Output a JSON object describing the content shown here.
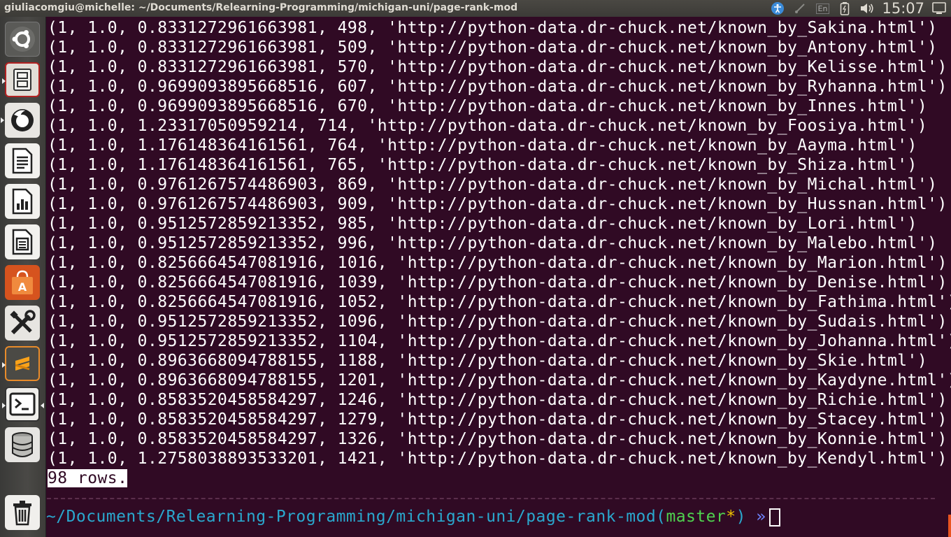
{
  "window": {
    "title": "giuliacomgiu@michelle: ~/Documents/Relearning-Programming/michigan-uni/page-rank-mod"
  },
  "tray": {
    "keyboard": "En",
    "clock": "15:07"
  },
  "launcher": {
    "items": [
      "ubuntu-dash",
      "files",
      "firefox",
      "libreoffice-writer",
      "libreoffice-calc",
      "libreoffice-impress",
      "software-center",
      "system-settings",
      "sublime-text",
      "terminal",
      "database",
      "trash"
    ]
  },
  "terminal": {
    "lines": [
      "(1, 1.0, 0.8331272961663981, 498, 'http://python-data.dr-chuck.net/known_by_Sakina.html')",
      "(1, 1.0, 0.8331272961663981, 509, 'http://python-data.dr-chuck.net/known_by_Antony.html')",
      "(1, 1.0, 0.8331272961663981, 570, 'http://python-data.dr-chuck.net/known_by_Kelisse.html')",
      "(1, 1.0, 0.9699093895668516, 607, 'http://python-data.dr-chuck.net/known_by_Ryhanna.html')",
      "(1, 1.0, 0.9699093895668516, 670, 'http://python-data.dr-chuck.net/known_by_Innes.html')",
      "(1, 1.0, 1.23317050959214, 714, 'http://python-data.dr-chuck.net/known_by_Foosiya.html')",
      "(1, 1.0, 1.176148364161561, 764, 'http://python-data.dr-chuck.net/known_by_Aayma.html')",
      "(1, 1.0, 1.176148364161561, 765, 'http://python-data.dr-chuck.net/known_by_Shiza.html')",
      "(1, 1.0, 0.9761267574486903, 869, 'http://python-data.dr-chuck.net/known_by_Michal.html')",
      "(1, 1.0, 0.9761267574486903, 909, 'http://python-data.dr-chuck.net/known_by_Hussnan.html')",
      "(1, 1.0, 0.9512572859213352, 985, 'http://python-data.dr-chuck.net/known_by_Lori.html')",
      "(1, 1.0, 0.9512572859213352, 996, 'http://python-data.dr-chuck.net/known_by_Malebo.html')",
      "(1, 1.0, 0.8256664547081916, 1016, 'http://python-data.dr-chuck.net/known_by_Marion.html')",
      "(1, 1.0, 0.8256664547081916, 1039, 'http://python-data.dr-chuck.net/known_by_Denise.html')",
      "(1, 1.0, 0.8256664547081916, 1052, 'http://python-data.dr-chuck.net/known_by_Fathima.html')",
      "(1, 1.0, 0.9512572859213352, 1096, 'http://python-data.dr-chuck.net/known_by_Sudais.html')",
      "(1, 1.0, 0.9512572859213352, 1104, 'http://python-data.dr-chuck.net/known_by_Johanna.html')",
      "(1, 1.0, 0.8963668094788155, 1188, 'http://python-data.dr-chuck.net/known_by_Skie.html')",
      "(1, 1.0, 0.8963668094788155, 1201, 'http://python-data.dr-chuck.net/known_by_Kaydyne.html')",
      "(1, 1.0, 0.8583520458584297, 1246, 'http://python-data.dr-chuck.net/known_by_Richie.html')",
      "(1, 1.0, 0.8583520458584297, 1279, 'http://python-data.dr-chuck.net/known_by_Stacey.html')",
      "(1, 1.0, 0.8583520458584297, 1326, 'http://python-data.dr-chuck.net/known_by_Konnie.html')",
      "(1, 1.0, 1.2758038893533201, 1421, 'http://python-data.dr-chuck.net/known_by_Kendyl.html')"
    ],
    "row_count": "98 rows.",
    "prompt": {
      "path": "~/Documents/Relearning-Programming/michigan-uni/page-rank-mod",
      "open_paren": "(",
      "branch": "master",
      "dirty": "*",
      "close_paren": ")",
      "arrow": "»"
    }
  },
  "colors": {
    "terminal_bg": "#300a24",
    "prompt_path": "#2aa8ce",
    "branch": "#4fd34f",
    "dirty": "#f0c400",
    "arrow": "#6f86ff"
  }
}
